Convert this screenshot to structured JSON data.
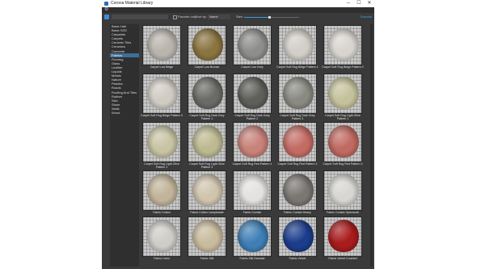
{
  "window": {
    "title": "Corona Material Library",
    "minimize_glyph": "─",
    "maximize_glyph": "☐",
    "close_glyph": "✕"
  },
  "toolbar": {
    "search": {
      "value": "",
      "placeholder": ""
    },
    "favorite_only_label": "Favorite only",
    "sort_by_label": "Sort by:",
    "sort_by_value": "Name",
    "size_label": "Size:",
    "size_level": 0.45,
    "right_link": "Scandia"
  },
  "categories": [
    {
      "label": "Basic Hair",
      "selected": false
    },
    {
      "label": "Basic SSS",
      "selected": false
    },
    {
      "label": "Carpaints",
      "selected": false
    },
    {
      "label": "Carpets",
      "selected": false
    },
    {
      "label": "Ceramic Tiles",
      "selected": false
    },
    {
      "label": "Ceramics",
      "selected": false
    },
    {
      "label": "Concrete",
      "selected": false
    },
    {
      "label": "Fabrics",
      "selected": true
    },
    {
      "label": "Flooring",
      "selected": false
    },
    {
      "label": "Glass",
      "selected": false
    },
    {
      "label": "Leather",
      "selected": false
    },
    {
      "label": "Liquids",
      "selected": false
    },
    {
      "label": "Metals",
      "selected": false
    },
    {
      "label": "Nature",
      "selected": false
    },
    {
      "label": "Plastics",
      "selected": false
    },
    {
      "label": "Roads",
      "selected": false
    },
    {
      "label": "Roofing And Tiles",
      "selected": false
    },
    {
      "label": "Rubber",
      "selected": false
    },
    {
      "label": "Skin",
      "selected": false
    },
    {
      "label": "Stone",
      "selected": false
    },
    {
      "label": "Walls",
      "selected": false
    },
    {
      "label": "Wood",
      "selected": false
    }
  ],
  "materials": [
    {
      "name": "Carpet Low Beige",
      "color": "#b9b5ad"
    },
    {
      "name": "Carpet Low Bronze",
      "color": "#8a7440"
    },
    {
      "name": "Carpet Low Grey",
      "color": "#8e8e8c"
    },
    {
      "name": "Carpet Soft Rug Beige Pattern 1",
      "color": "#d2cec8"
    },
    {
      "name": "Carpet Soft Rug Beige Pattern 2",
      "color": "#d8d5d0"
    },
    {
      "name": "Carpet Soft Rug Beige Pattern 3",
      "color": "#d0ccc4"
    },
    {
      "name": "Carpet Soft Rug Dark Grey Pattern 1",
      "color": "#6a6a66"
    },
    {
      "name": "Carpet Soft Rug Dark Grey Pattern 2",
      "color": "#5e5e5a"
    },
    {
      "name": "Carpet Soft Rug Dark Grey Pattern 3",
      "color": "#8a8a82"
    },
    {
      "name": "Carpet Soft Rug Light Olive Pattern 1",
      "color": "#c4c29c"
    },
    {
      "name": "Carpet Soft Rug Light Olive Pattern 2",
      "color": "#c8c4a4"
    },
    {
      "name": "Carpet Soft Rug Light Olive Pattern 3",
      "color": "#bdb992"
    },
    {
      "name": "Carpet Soft Rug Red Pattern 1",
      "color": "#c8827a"
    },
    {
      "name": "Carpet Soft Rug Red Pattern 2",
      "color": "#c46c64"
    },
    {
      "name": "Carpet Soft Rug Red Pattern 3",
      "color": "#c06a62"
    },
    {
      "name": "Fabric Cotton",
      "color": "#c2b49a"
    },
    {
      "name": "Fabric Cotton Lampshade",
      "color": "#d0c4ae"
    },
    {
      "name": "Fabric Curtain",
      "color": "#e4e2e0"
    },
    {
      "name": "Fabric Curtain Heavy",
      "color": "#7a7672"
    },
    {
      "name": "Fabric Curtain Openwork",
      "color": "#d8d6d2"
    },
    {
      "name": "Fabric Linen",
      "color": "#cfcdc8"
    },
    {
      "name": "Fabric Silk",
      "color": "#c9bb9e"
    },
    {
      "name": "Fabric Silk Damask",
      "color": "#3f7fb5"
    },
    {
      "name": "Fabric Velvet",
      "color": "#1c3d8c"
    },
    {
      "name": "Fabric Velvet Crushed",
      "color": "#a81c1c"
    }
  ]
}
